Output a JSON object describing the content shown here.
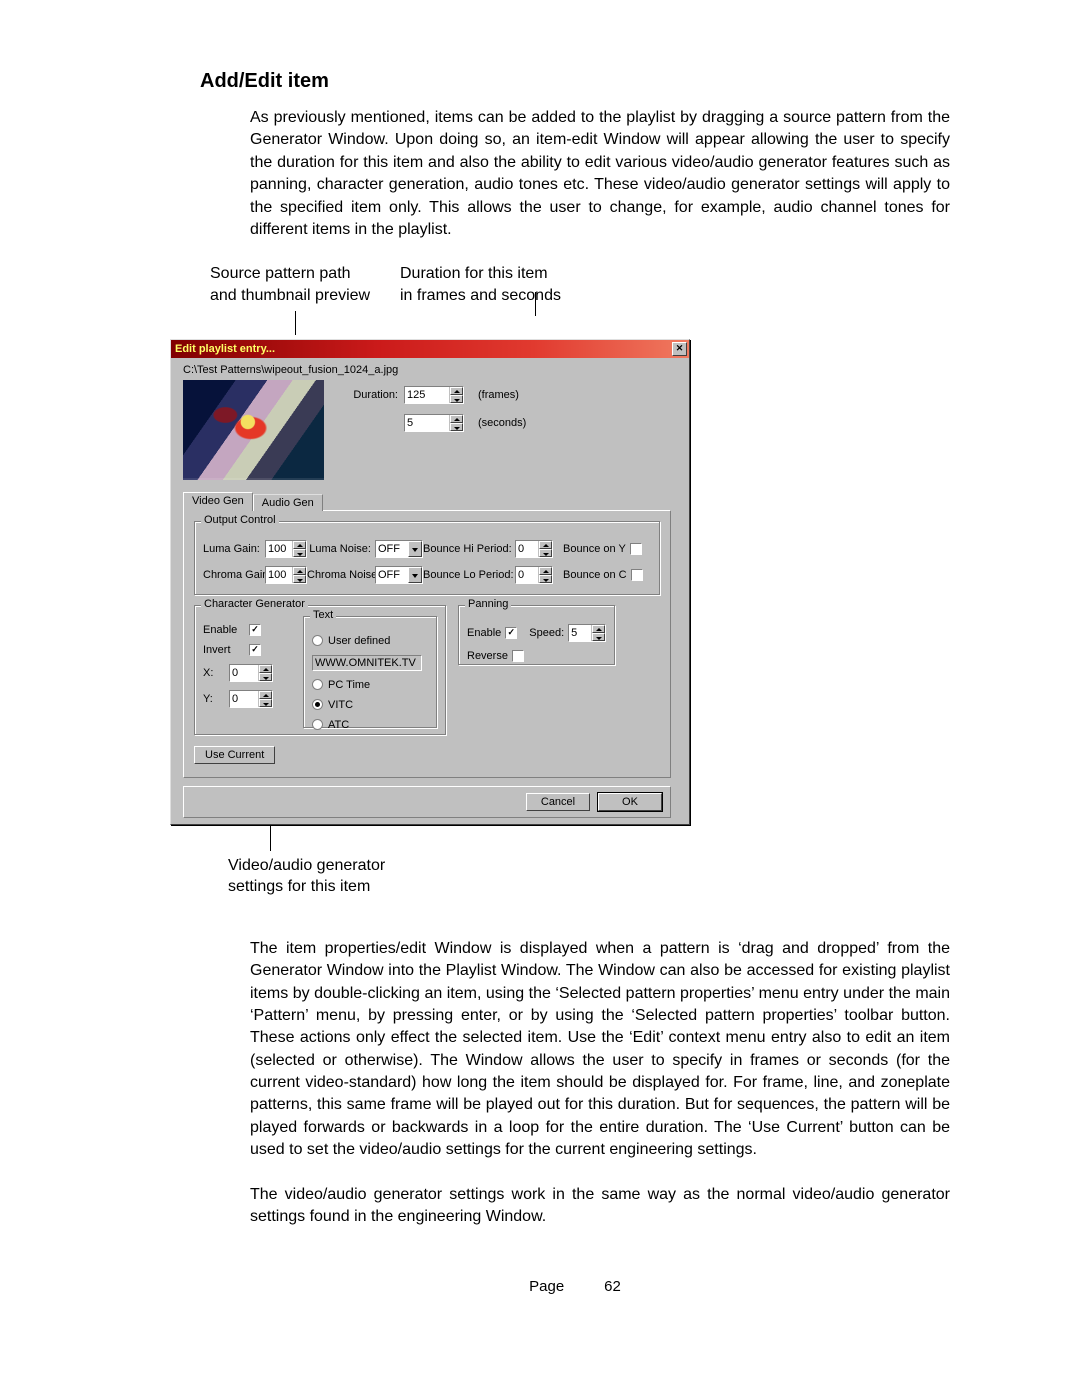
{
  "doc": {
    "heading": "Add/Edit item",
    "intro": "As previously mentioned, items can be added to the playlist by dragging a source pattern from the Generator Window.  Upon doing so, an item-edit Window will appear allowing the user to specify the duration for this item and also the ability to edit various video/audio generator features such as panning, character generation, audio tones etc.  These video/audio generator settings will apply to the specified item only.  This allows the user to change, for example, audio channel tones for different items in the playlist.",
    "callout1a": "Source pattern path",
    "callout1b": "and thumbnail preview",
    "callout2a": "Duration for this item",
    "callout2b": "in frames and seconds",
    "callout3a": "Video/audio generator",
    "callout3b": "settings for this item",
    "para2": "The item properties/edit Window is displayed when a pattern is ‘drag and dropped’ from the Generator Window into the Playlist Window.  The Window can also be accessed for existing playlist items by double-clicking an item, using the ‘Selected pattern properties’ menu entry under the main ‘Pattern’ menu, by pressing enter, or by using the ‘Selected pattern properties’ toolbar button.  These actions only effect the selected item.  Use the ‘Edit’ context menu entry also to edit an item (selected or otherwise).  The Window allows the user to specify in frames or seconds (for the current video-standard) how long the item should be displayed for.  For frame, line, and zoneplate patterns, this same frame will be played out for this duration.  But for sequences, the pattern will be played forwards or backwards in a loop for the entire duration.  The ‘Use Current’ button can be used to set the video/audio settings for the current engineering settings.",
    "para3": "The video/audio generator settings work in the same way as the normal video/audio generator settings found in the engineering Window.",
    "page_label": "Page",
    "page_num": "62"
  },
  "dialog": {
    "title": "Edit playlist entry...",
    "path": "C:\\Test Patterns\\wipeout_fusion_1024_a.jpg",
    "duration_label": "Duration:",
    "frames_value": "125",
    "frames_unit": "(frames)",
    "seconds_value": "5",
    "seconds_unit": "(seconds)",
    "tabs": {
      "video": "Video Gen",
      "audio": "Audio Gen"
    },
    "output_control": {
      "title": "Output Control",
      "luma_gain_lbl": "Luma Gain:",
      "luma_gain": "100",
      "luma_noise_lbl": "Luma Noise:",
      "luma_noise": "OFF",
      "bounce_hi_lbl": "Bounce Hi Period:",
      "bounce_hi": "0",
      "bounce_y_lbl": "Bounce on Y",
      "chroma_gain_lbl": "Chroma Gain:",
      "chroma_gain": "100",
      "chroma_noise_lbl": "Chroma Noise:",
      "chroma_noise": "OFF",
      "bounce_lo_lbl": "Bounce Lo Period:",
      "bounce_lo": "0",
      "bounce_c_lbl": "Bounce on C"
    },
    "chargen": {
      "title": "Character Generator",
      "enable": "Enable",
      "invert": "Invert",
      "x": "X:",
      "x_val": "0",
      "y": "Y:",
      "y_val": "0",
      "text_title": "Text",
      "user_defined": "User defined",
      "user_text": "WWW.OMNITEK.TV",
      "pc_time": "PC Time",
      "vitc": "VITC",
      "atc": "ATC"
    },
    "panning": {
      "title": "Panning",
      "enable": "Enable",
      "speed_lbl": "Speed:",
      "speed": "5",
      "reverse": "Reverse"
    },
    "use_current": "Use Current",
    "cancel": "Cancel",
    "ok": "OK"
  }
}
